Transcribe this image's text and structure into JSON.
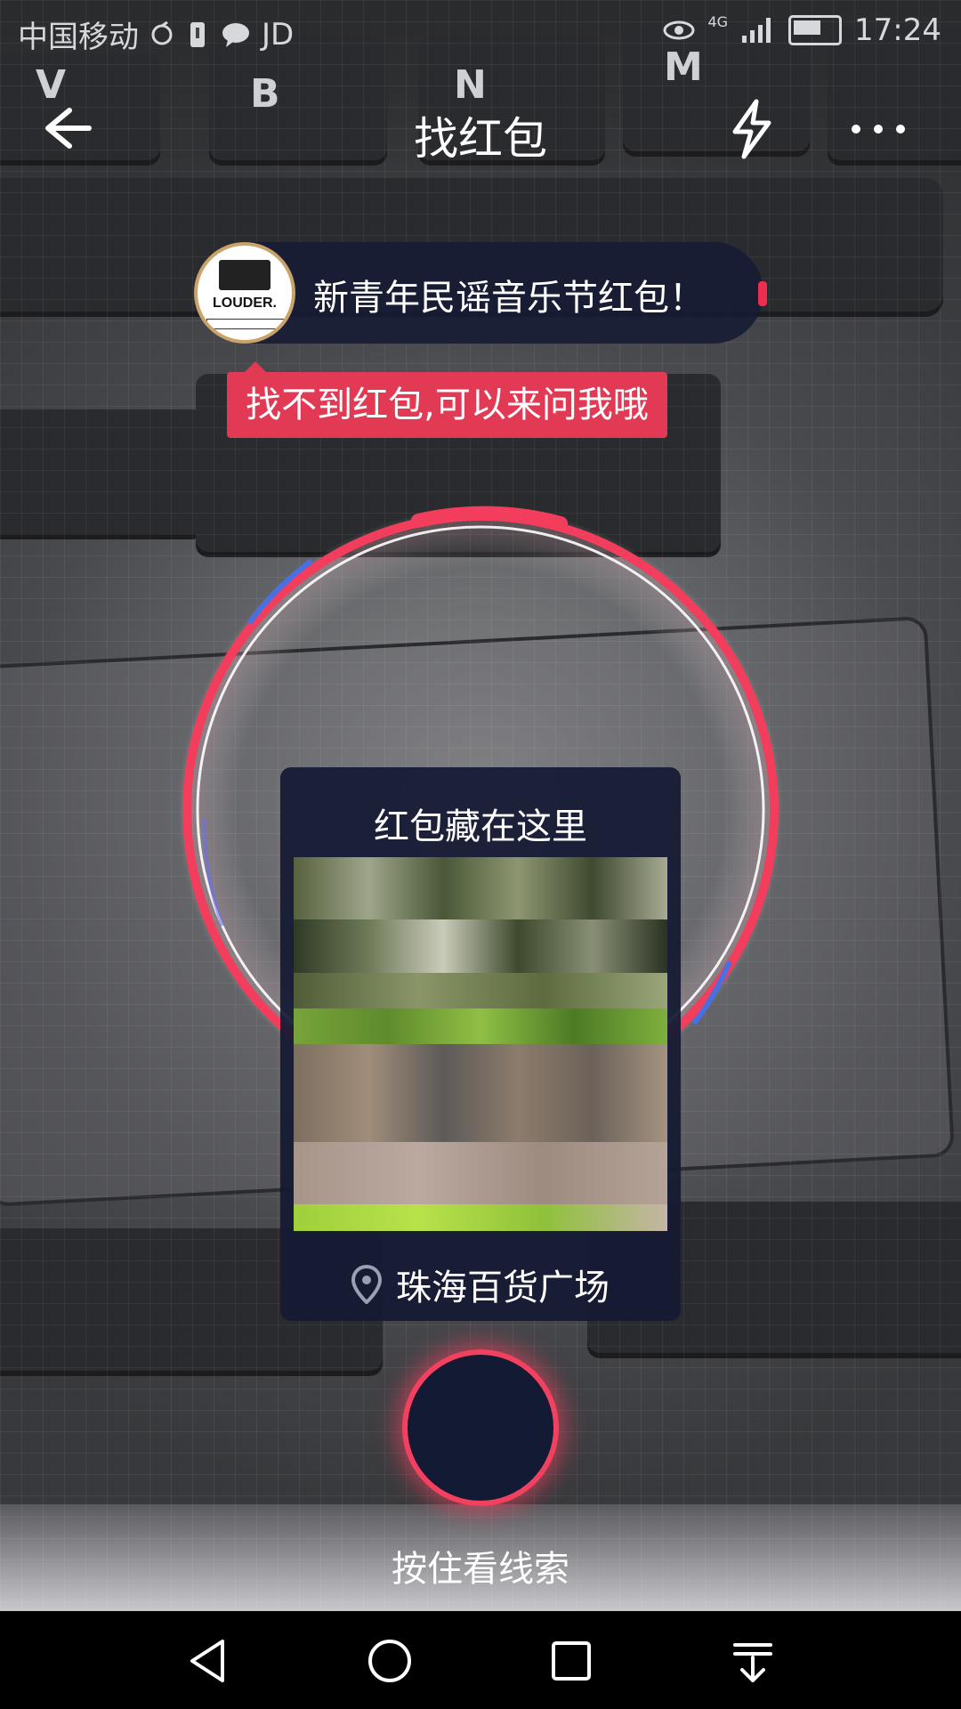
{
  "status_bar": {
    "carrier": "中国移动",
    "app_badge": "JD",
    "network": "4G",
    "time": "17:24"
  },
  "header": {
    "title": "找红包",
    "back_icon": "back-arrow-icon",
    "flash_icon": "lightning-icon",
    "more_icon": "more-dots-icon"
  },
  "banner": {
    "logo_text": "LOUDER.",
    "text": "新青年民谣音乐节红包！"
  },
  "hint": {
    "text": "找不到红包,可以来问我哦"
  },
  "clue_card": {
    "title": "红包藏在这里",
    "location": "珠海百货广场"
  },
  "hold_button": {
    "label": "按住看线索"
  },
  "colors": {
    "accent_red": "#f2405f",
    "card_bg": "#141a34",
    "ring_blue": "#4a6fe0"
  },
  "nav_bar": {
    "icons": [
      "back-triangle-icon",
      "home-circle-icon",
      "recents-square-icon",
      "notification-pull-icon"
    ]
  }
}
